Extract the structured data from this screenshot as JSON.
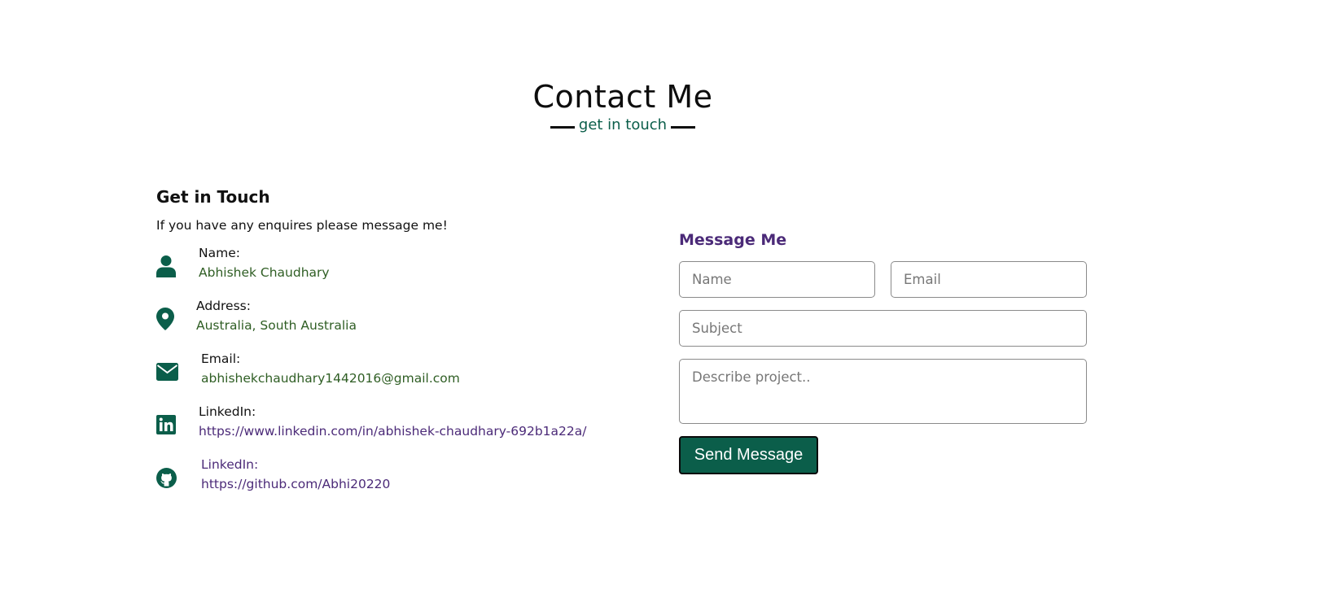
{
  "header": {
    "title": "Contact Me",
    "subtitle": "get in touch"
  },
  "contact_info": {
    "heading": "Get in Touch",
    "intro": "If you have any enquires please message me!",
    "items": [
      {
        "icon": "user-icon",
        "label": "Name:",
        "value": "Abhishek Chaudhary"
      },
      {
        "icon": "location-pin-icon",
        "label": "Address:",
        "value": "Australia, South Australia"
      },
      {
        "icon": "envelope-icon",
        "label": "Email:",
        "value": "abhishekchaudhary1442016@gmail.com"
      },
      {
        "icon": "linkedin-icon",
        "label": "LinkedIn:",
        "value": "https://www.linkedin.com/in/abhishek-chaudhary-692b1a22a/"
      },
      {
        "icon": "github-icon",
        "label": "LinkedIn:",
        "value": "https://github.com/Abhi20220"
      }
    ]
  },
  "form": {
    "title": "Message Me",
    "name_placeholder": "Name",
    "email_placeholder": "Email",
    "subject_placeholder": "Subject",
    "description_placeholder": "Describe project..",
    "submit_label": "Send Message"
  },
  "colors": {
    "accent_green": "#0b5e4a",
    "value_green": "#2f5e24",
    "accent_purple": "#4b2a78"
  }
}
